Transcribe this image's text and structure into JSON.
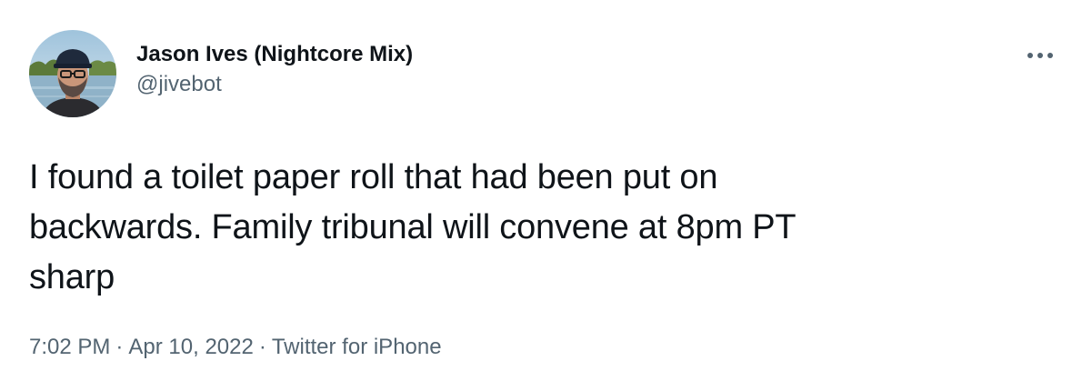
{
  "tweet": {
    "author": {
      "display_name": "Jason Ives (Nightcore Mix)",
      "handle": "@jivebot",
      "avatar_icon": "avatar-photo"
    },
    "text": "I found a toilet paper roll that had been put on\nbackwards. Family tribunal will convene at 8pm PT\nsharp",
    "meta": {
      "time": "7:02 PM",
      "separator": "·",
      "date": "Apr 10, 2022",
      "source": "Twitter for iPhone"
    },
    "more_icon": "more-options-icon"
  },
  "colors": {
    "primary_text": "#0f1419",
    "secondary_text": "#536471",
    "background": "#ffffff"
  }
}
